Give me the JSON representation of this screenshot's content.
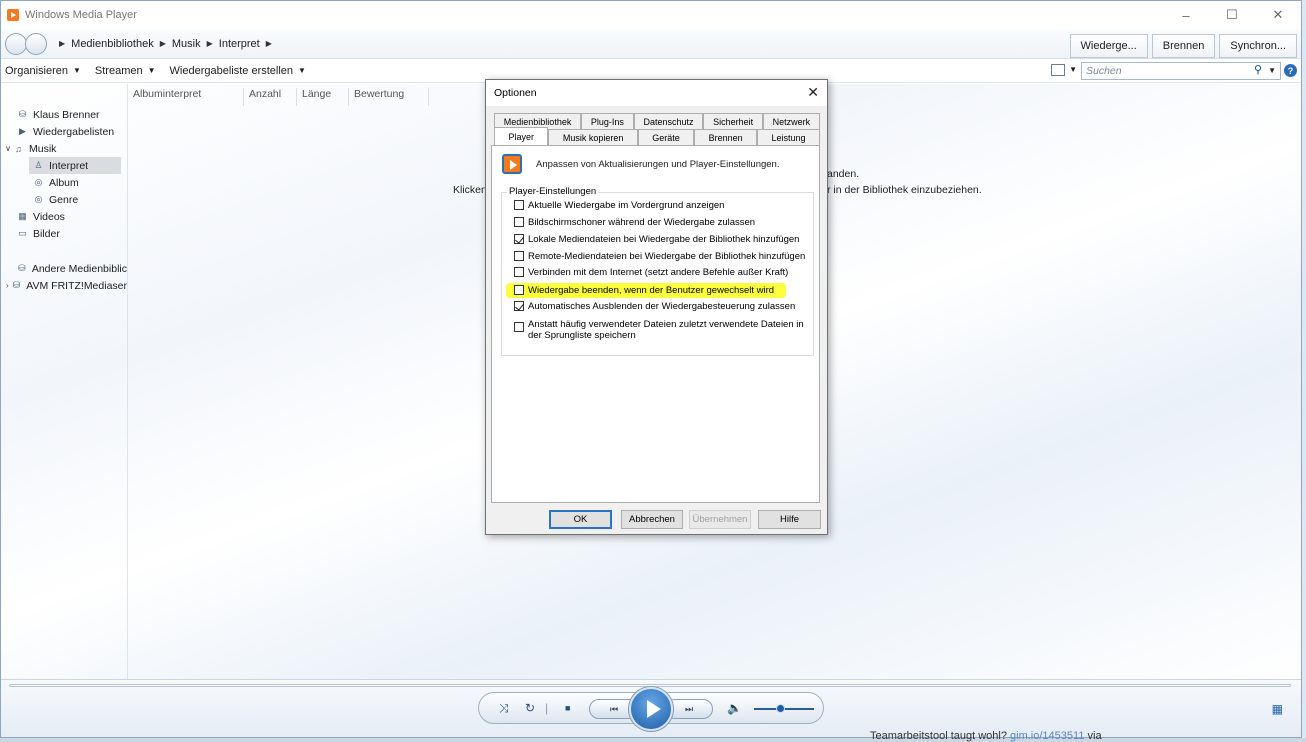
{
  "window": {
    "title": "Windows Media Player",
    "controls": [
      "–",
      "☐",
      "✕"
    ]
  },
  "nav": {
    "breadcrumb": [
      "Medienbibliothek",
      "Musik",
      "Interpret"
    ],
    "tabs": [
      "Wiederge...",
      "Brennen",
      "Synchron..."
    ]
  },
  "toolbar": {
    "organize": "Organisieren",
    "stream": "Streamen",
    "create_playlist": "Wiedergabeliste erstellen",
    "search_placeholder": "Suchen"
  },
  "sidebar": {
    "user": "Klaus Brenner",
    "playlists": "Wiedergabelisten",
    "music": "Musik",
    "artist": "Interpret",
    "album": "Album",
    "genre": "Genre",
    "videos": "Videos",
    "pictures": "Bilder",
    "other_libraries": "Andere Medienbiblic",
    "media_server": "AVM FRITZ!Mediaser"
  },
  "columns": [
    "Albuminterpret",
    "Anzahl",
    "Länge",
    "Bewertung"
  ],
  "background_text": {
    "left": "Klicken",
    "right_1": "anden.",
    "right_2": "r in der Bibliothek einzubeziehen.",
    "bottom": "Teamarbeitstool taugt wohl?",
    "bottom_link": "gim.io/1453511",
    "bottom_tail": "via"
  },
  "dialog": {
    "title": "Optionen",
    "tabs_back": [
      "Medienbibliothek",
      "Plug-Ins",
      "Datenschutz",
      "Sicherheit",
      "Netzwerk"
    ],
    "tabs_front": [
      "Player",
      "Musik kopieren",
      "Geräte",
      "Brennen",
      "Leistung"
    ],
    "active_tab": "Player",
    "intro": "Anpassen von Aktualisierungen und Player-Einstellungen.",
    "group_label": "Player-Einstellungen",
    "options": [
      {
        "label": "Aktuelle Wiedergabe im Vordergrund anzeigen",
        "checked": false
      },
      {
        "label": "Bildschirmschoner während der Wiedergabe zulassen",
        "checked": false
      },
      {
        "label": "Lokale Mediendateien bei Wiedergabe der Bibliothek hinzufügen",
        "checked": true
      },
      {
        "label": "Remote-Mediendateien bei Wiedergabe der Bibliothek hinzufügen",
        "checked": false
      },
      {
        "label": "Verbinden mit dem Internet (setzt andere Befehle außer Kraft)",
        "checked": false
      },
      {
        "label": "Wiedergabe beenden, wenn der Benutzer gewechselt wird",
        "checked": false,
        "highlighted": true
      },
      {
        "label": "Automatisches Ausblenden der Wiedergabesteuerung zulassen",
        "checked": true
      },
      {
        "label": "Anstatt häufig verwendeter Dateien zuletzt verwendete Dateien in der Sprungliste speichern",
        "checked": false
      }
    ],
    "buttons": {
      "ok": "OK",
      "cancel": "Abbrechen",
      "apply": "Übernehmen",
      "help": "Hilfe"
    },
    "highlight_color": "#fbff3c"
  }
}
